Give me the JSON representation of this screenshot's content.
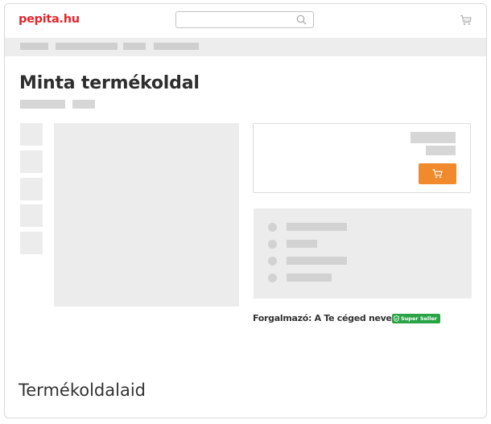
{
  "header": {
    "logo": "pepita.hu",
    "search": {
      "value": "",
      "placeholder": ""
    },
    "search_icon": "search-icon",
    "cart_icon": "shopping-cart-icon"
  },
  "product": {
    "title": "Minta termékoldal",
    "add_to_cart_icon": "shopping-cart-icon",
    "seller_text": "Forgalmazó: A Te céged neve",
    "badge_label": "Super Seller",
    "badge_icon": "shield-check-icon"
  },
  "caption": "Termékoldalaid",
  "colors": {
    "brand": "#e3262b",
    "cart_button": "#f18a2c",
    "badge": "#2aa347",
    "placeholder": "#ececec"
  }
}
